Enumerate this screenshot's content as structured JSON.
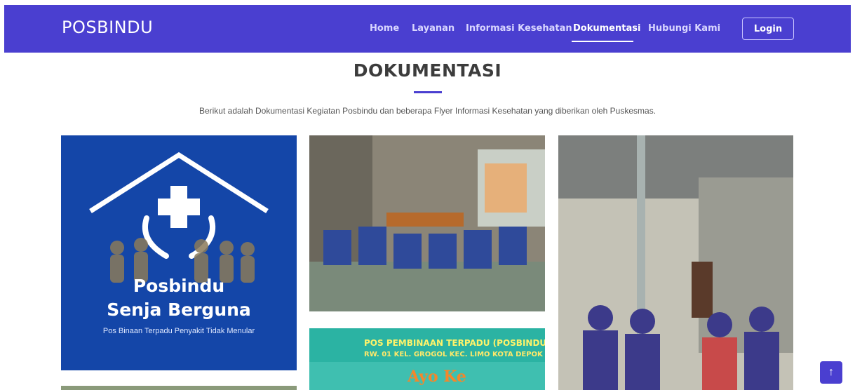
{
  "brand": "POSBINDU",
  "nav": {
    "items": [
      {
        "label": "Home"
      },
      {
        "label": "Layanan"
      },
      {
        "label": "Informasi Kesehatan"
      },
      {
        "label": "Dokumentasi"
      },
      {
        "label": "Hubungi Kami"
      }
    ],
    "active": "Dokumentasi",
    "login_label": "Login"
  },
  "section": {
    "title": "DOKUMENTASI",
    "subtitle": "Berikut adalah Dokumentasi Kegiatan Posbindu dan beberapa Flyer Informasi Kesehatan yang diberikan oleh Puskesmas."
  },
  "gallery": {
    "logo": {
      "line1": "Posbindu",
      "line2": "Senja Berguna",
      "caption": "Pos Binaan Terpadu Penyakit Tidak Menular"
    },
    "flyer": {
      "line1": "POS PEMBINAAN TERPADU (POSBINDU)",
      "line2": "RW. 01 KEL. GROGOL KEC. LIMO KOTA DEPOK",
      "big": "Ayo Ke"
    }
  },
  "icons": {
    "back_to_top": "arrow-up-icon"
  },
  "colors": {
    "primary": "#4a3fd0",
    "logo_bg": "#1446a8"
  }
}
